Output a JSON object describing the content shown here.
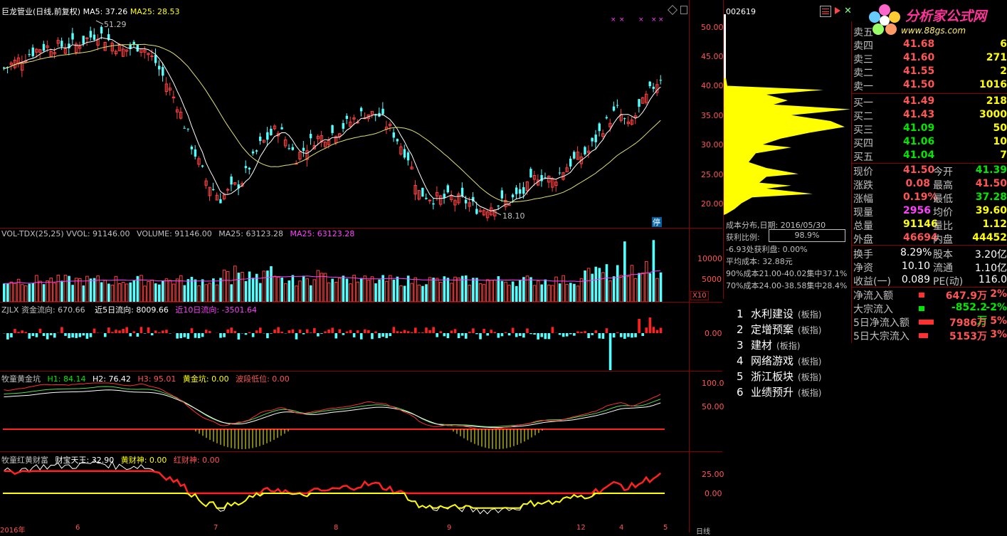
{
  "header": {
    "title": "巨龙管业(日线,前复权)",
    "ma5_label": "MA5: 37.26",
    "ma25_label": "MA25: 28.53",
    "code": "002619"
  },
  "brand": {
    "name": "分析家公式网",
    "url": "www.88gs.com"
  },
  "price_axis": [
    "50.00",
    "45.00",
    "40.00",
    "35.00",
    "30.00",
    "25.00",
    "20.00"
  ],
  "annotations": {
    "high": "51.29",
    "low": "18.10",
    "halt": "停"
  },
  "volume": {
    "label": "VOL-TDX(25,25) VVOL: 91146.00",
    "volume": "VOLUME: 91146.00",
    "ma25": "MA25: 63123.28",
    "ma25b": "MA25: 63123.28",
    "axis": [
      "10000",
      "5000"
    ],
    "unit": "X10"
  },
  "zjlx": {
    "label": "ZJLX 资金流向: 670.66",
    "d5": "近5日流向: 8009.66",
    "d10": "近10日流向: -3501.64",
    "axis": "0.00"
  },
  "ind1": {
    "label": "牧童黄金坑",
    "h1": "H1: 84.14",
    "h2": "H2: 76.42",
    "h3": "H3: 95.01",
    "pit": "黄金坑: 0.00",
    "low": "波段低位: 0.00",
    "axis": [
      "100.0",
      "50.00"
    ]
  },
  "ind2": {
    "label": "牧童红黄财富",
    "king": "财宝天王: 32.90",
    "yellow": "黄财神: 0.00",
    "red": "红财神: 0.00",
    "axis": [
      "25.00",
      "0.00"
    ]
  },
  "xaxis": [
    "2016年",
    "6",
    "7",
    "8",
    "9",
    "12",
    "4",
    "5",
    "日线"
  ],
  "cost": {
    "date": "成本分布,日期: 2016/05/30",
    "profit_label": "获利比例:",
    "profit_value": "98.9%",
    "line1": "-6.93处获利盘: 0.00%",
    "line2": "平均成本: 32.88元",
    "line3": "90%成本21.00-40.02集中37.1%",
    "line4": "70%成本24.00-38.58集中28.4%"
  },
  "orderbook": {
    "sell": [
      {
        "label": "卖五",
        "price": "",
        "vol": ""
      },
      {
        "label": "卖四",
        "price": "41.68",
        "vol": "6"
      },
      {
        "label": "卖三",
        "price": "41.60",
        "vol": "271"
      },
      {
        "label": "卖二",
        "price": "41.55",
        "vol": "2"
      },
      {
        "label": "卖一",
        "price": "41.50",
        "vol": "1016"
      }
    ],
    "buy": [
      {
        "label": "买一",
        "price": "41.49",
        "vol": "218"
      },
      {
        "label": "买二",
        "price": "41.43",
        "vol": "3000"
      },
      {
        "label": "买三",
        "price": "41.09",
        "vol": "50"
      },
      {
        "label": "买四",
        "price": "41.06",
        "vol": "10"
      },
      {
        "label": "买五",
        "price": "41.04",
        "vol": "7"
      }
    ]
  },
  "quotes": [
    {
      "l1": "现价",
      "v1": "41.50",
      "l2": "今开",
      "v2": "41.39"
    },
    {
      "l1": "涨跌",
      "v1": "0.08",
      "l2": "最高",
      "v2": "41.50"
    },
    {
      "l1": "涨幅",
      "v1": "0.19%",
      "l2": "最低",
      "v2": "37.28"
    },
    {
      "l1": "现量",
      "v1": "2956",
      "l2": "均价",
      "v2": "39.60"
    },
    {
      "l1": "总量",
      "v1": "91146",
      "l2": "量比",
      "v2": "1.12"
    },
    {
      "l1": "外盘",
      "v1": "46694",
      "l2": "内盘",
      "v2": "44452"
    }
  ],
  "fundamentals": [
    {
      "l1": "换手",
      "v1": "8.29%",
      "l2": "股本",
      "v2": "3.20亿"
    },
    {
      "l1": "净资",
      "v1": "10.10",
      "l2": "流通",
      "v2": "1.10亿"
    },
    {
      "l1": "收益(一)",
      "v1": "0.089",
      "l2": "PE(动)",
      "v2": "116.0"
    }
  ],
  "flows": [
    {
      "label": "净流入额",
      "value": "647.9万",
      "pct": "2%",
      "bar": 0.02
    },
    {
      "label": "大宗流入",
      "value": "-852.2万",
      "pct": "-2%",
      "bar": 0.02
    },
    {
      "label": "5日净流入额",
      "value": "7986万",
      "pct": "5%",
      "bar": 0.05
    },
    {
      "label": "5日大宗流入",
      "value": "5153万",
      "pct": "3%",
      "bar": 0.03
    }
  ],
  "sectors": [
    {
      "no": "1",
      "name": "水利建设",
      "tag": "(板指)"
    },
    {
      "no": "2",
      "name": "定增预案",
      "tag": "(板指)"
    },
    {
      "no": "3",
      "name": "建材",
      "tag": "(板指)"
    },
    {
      "no": "4",
      "name": "网络游戏",
      "tag": "(板指)"
    },
    {
      "no": "5",
      "name": "浙江板块",
      "tag": "(板指)"
    },
    {
      "no": "6",
      "name": "业绩预升",
      "tag": "(板指)"
    }
  ]
}
